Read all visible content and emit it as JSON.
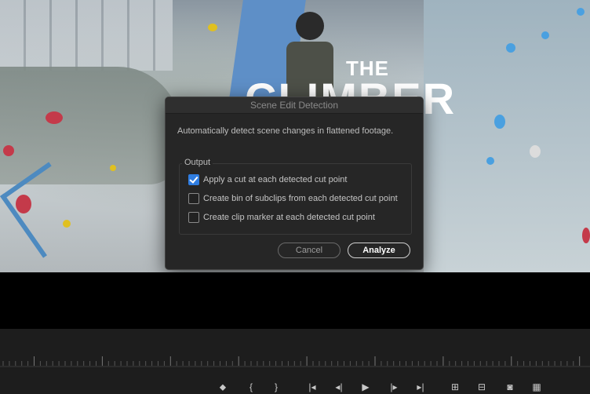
{
  "video": {
    "title_small": "THE",
    "title_big": "CLIMBER"
  },
  "dialog": {
    "title": "Scene Edit Detection",
    "description": "Automatically detect scene changes in flattened footage.",
    "output_label": "Output",
    "options": [
      {
        "label": "Apply a cut at each detected cut point",
        "checked": true
      },
      {
        "label": "Create bin of subclips from each detected cut point",
        "checked": false
      },
      {
        "label": "Create clip marker at each detected cut point",
        "checked": false
      }
    ],
    "cancel_label": "Cancel",
    "analyze_label": "Analyze"
  },
  "transport": {
    "buttons": [
      {
        "name": "add-marker-icon",
        "glyph": "⬥"
      },
      {
        "name": "mark-in-icon",
        "glyph": "{"
      },
      {
        "name": "mark-out-icon",
        "glyph": "}"
      },
      {
        "name": "go-to-in-icon",
        "glyph": "|◂"
      },
      {
        "name": "step-back-icon",
        "glyph": "◂|"
      },
      {
        "name": "play-icon",
        "glyph": "▶"
      },
      {
        "name": "step-forward-icon",
        "glyph": "|▸"
      },
      {
        "name": "go-to-out-icon",
        "glyph": "▸|"
      },
      {
        "name": "lift-icon",
        "glyph": "⊞"
      },
      {
        "name": "extract-icon",
        "glyph": "⊟"
      },
      {
        "name": "export-frame-icon",
        "glyph": "◙"
      },
      {
        "name": "comparison-view-icon",
        "glyph": "▦"
      }
    ]
  },
  "colors": {
    "accent": "#2f7de1",
    "dialog_bg": "#262626"
  }
}
